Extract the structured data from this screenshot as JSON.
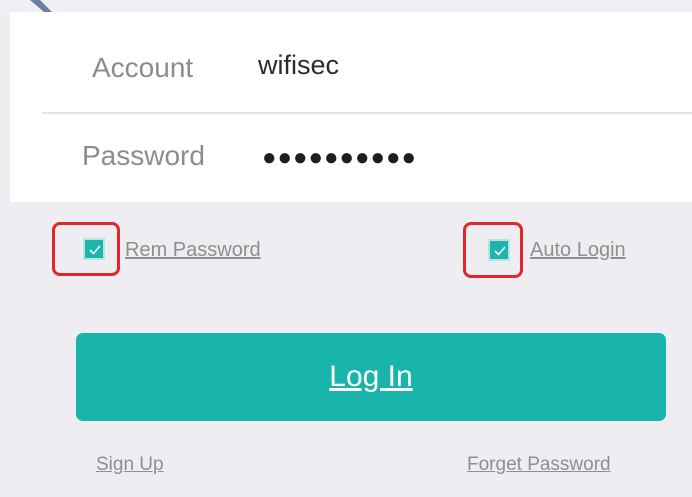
{
  "form": {
    "account_label": "Account",
    "account_value": "wifisec",
    "password_label": "Password",
    "password_masked": "●●●●●●●●●●"
  },
  "options": {
    "rem_password_label": "Rem Password",
    "rem_password_checked": true,
    "auto_login_label": "Auto Login",
    "auto_login_checked": true,
    "highlight_color": "#e3262c",
    "checkbox_color": "#1db5ad"
  },
  "actions": {
    "login_label": "Log In",
    "login_color": "#19b4ab",
    "signup_label": "Sign Up",
    "forget_label": "Forget Password"
  }
}
